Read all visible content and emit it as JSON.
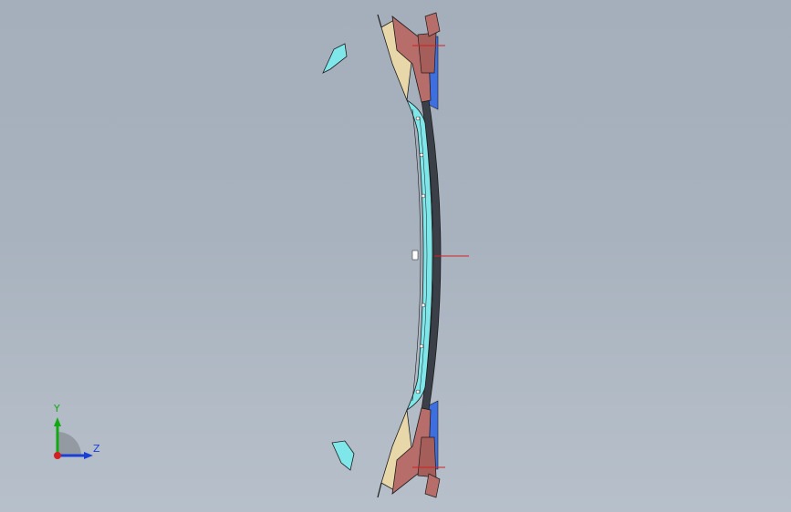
{
  "viewport": {
    "background_top": "#a5afbb",
    "background_bottom": "#b7c0ca"
  },
  "model": {
    "description_icon": "cad-assembly-side-view",
    "colors": {
      "cyan_part": "#7fe6ea",
      "brown_bracket": "#b76d6a",
      "tan_part": "#e8d7a8",
      "blue_panel": "#3d6fe0",
      "red_marker": "#d42020",
      "edge": "#1c1c1c"
    }
  },
  "triad": {
    "y_label": "Y",
    "z_label": "Z",
    "y_color": "#12a812",
    "z_color": "#1a3fd6",
    "origin_color": "#d42020"
  }
}
